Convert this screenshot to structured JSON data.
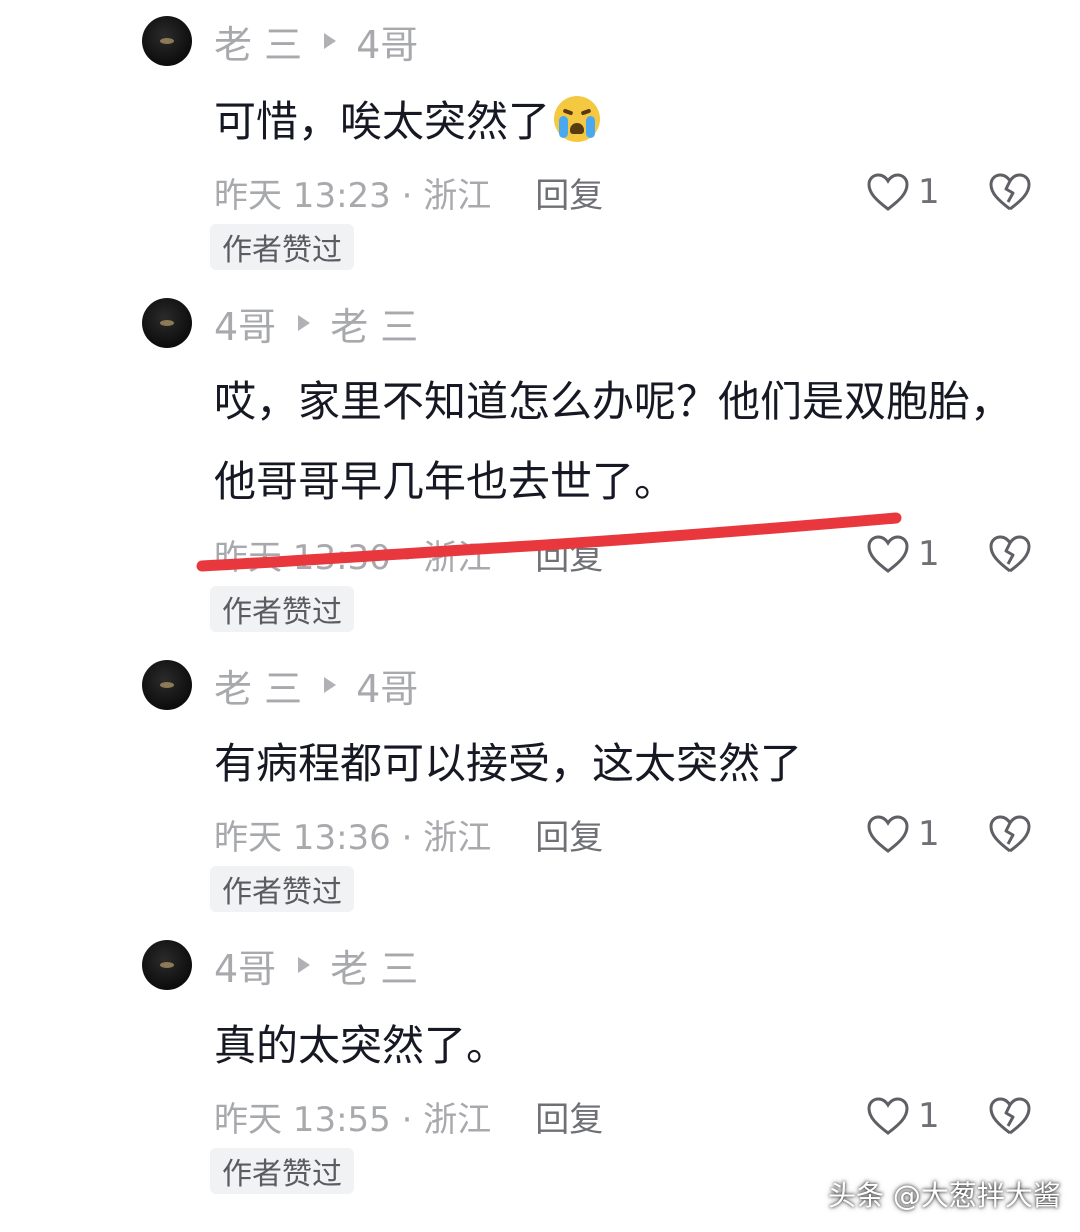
{
  "comments": [
    {
      "author": "老 三",
      "reply_to": "4哥",
      "avatar_glyph": "",
      "text": "可惜，唉太突然了",
      "emoji": "loudly-crying-face",
      "time": "昨天 13:23 · 浙江",
      "reply_label": "回复",
      "likes": "1",
      "badge": "作者赞过"
    },
    {
      "author": "4哥",
      "reply_to": "老 三",
      "avatar_glyph": "",
      "text": "哎，家里不知道怎么办呢？他们是双胞胎，他哥哥早几年也去世了。",
      "time": "昨天 13:30 · 浙江",
      "reply_label": "回复",
      "likes": "1",
      "badge": "作者赞过"
    },
    {
      "author": "老 三",
      "reply_to": "4哥",
      "avatar_glyph": "",
      "text": "有病程都可以接受，这太突然了",
      "time": "昨天 13:36 · 浙江",
      "reply_label": "回复",
      "likes": "1",
      "badge": "作者赞过"
    },
    {
      "author": "4哥",
      "reply_to": "老 三",
      "avatar_glyph": "",
      "text": "真的太突然了。",
      "time": "昨天 13:55 · 浙江",
      "reply_label": "回复",
      "likes": "1",
      "badge": "作者赞过"
    }
  ],
  "annotation_color": "#e8383d",
  "watermark": "头条 @大葱拌大酱",
  "icons": {
    "like": "heart-outline-icon",
    "dislike": "broken-heart-icon",
    "reply_arrow": "triangle-right-icon"
  }
}
